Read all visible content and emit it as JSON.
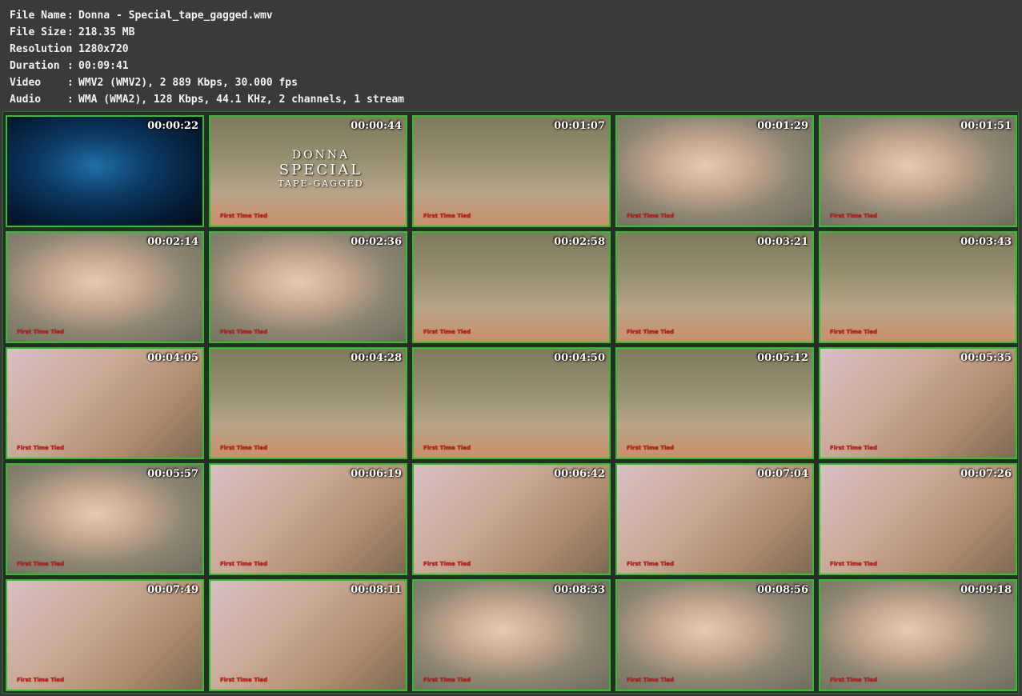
{
  "info": {
    "file_name_label": "File Name",
    "file_name": "Donna - Special_tape_gagged.wmv",
    "file_size_label": "File Size",
    "file_size": "218.35 MB",
    "resolution_label": "Resolution",
    "resolution": "1280x720",
    "duration_label": "Duration",
    "duration": "00:09:41",
    "video_label": "Video",
    "video": "WMV2 (WMV2), 2 889 Kbps, 30.000 fps",
    "audio_label": "Audio",
    "audio": "WMA (WMA2), 128 Kbps, 44.1 KHz, 2 channels, 1 stream",
    "separator": ":"
  },
  "title_card": {
    "line1": "DONNA",
    "line2": "SPECIAL",
    "line3": "TAPE-GAGGED"
  },
  "watermark": "First Time Tied",
  "thumbnails": [
    {
      "ts": "00:00:22",
      "scene": "blue"
    },
    {
      "ts": "00:00:44",
      "scene": "room"
    },
    {
      "ts": "00:01:07",
      "scene": "room"
    },
    {
      "ts": "00:01:29",
      "scene": "face"
    },
    {
      "ts": "00:01:51",
      "scene": "face"
    },
    {
      "ts": "00:02:14",
      "scene": "face"
    },
    {
      "ts": "00:02:36",
      "scene": "face"
    },
    {
      "ts": "00:02:58",
      "scene": "room"
    },
    {
      "ts": "00:03:21",
      "scene": "room"
    },
    {
      "ts": "00:03:43",
      "scene": "room"
    },
    {
      "ts": "00:04:05",
      "scene": "close"
    },
    {
      "ts": "00:04:28",
      "scene": "room"
    },
    {
      "ts": "00:04:50",
      "scene": "room"
    },
    {
      "ts": "00:05:12",
      "scene": "room"
    },
    {
      "ts": "00:05:35",
      "scene": "close"
    },
    {
      "ts": "00:05:57",
      "scene": "face"
    },
    {
      "ts": "00:06:19",
      "scene": "close"
    },
    {
      "ts": "00:06:42",
      "scene": "close"
    },
    {
      "ts": "00:07:04",
      "scene": "close"
    },
    {
      "ts": "00:07:26",
      "scene": "close"
    },
    {
      "ts": "00:07:49",
      "scene": "close"
    },
    {
      "ts": "00:08:11",
      "scene": "close"
    },
    {
      "ts": "00:08:33",
      "scene": "face"
    },
    {
      "ts": "00:08:56",
      "scene": "face"
    },
    {
      "ts": "00:09:18",
      "scene": "face"
    }
  ],
  "colors": {
    "thumb_border": "#24c824",
    "watermark": "#e21a1a"
  }
}
